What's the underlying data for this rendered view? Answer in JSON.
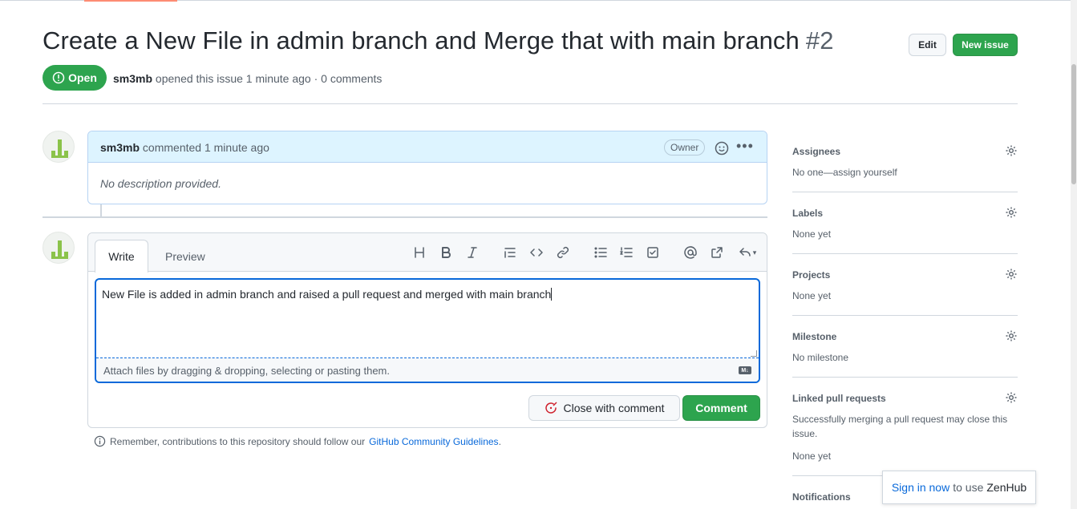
{
  "issue": {
    "title": "Create a New File in admin branch and Merge that with main branch",
    "number": "#2",
    "state": "Open",
    "author": "sm3mb",
    "meta_rest": "opened this issue 1 minute ago · 0 comments"
  },
  "header_buttons": {
    "edit": "Edit",
    "new_issue": "New issue"
  },
  "comment": {
    "author": "sm3mb",
    "action": "commented 1 minute ago",
    "badge": "Owner",
    "body": "No description provided."
  },
  "editor": {
    "tab_write": "Write",
    "tab_preview": "Preview",
    "toolbar": [
      "heading-icon",
      "bold-icon",
      "italic-icon",
      "quote-icon",
      "code-icon",
      "link-icon",
      "bulleted-list-icon",
      "numbered-list-icon",
      "task-list-icon",
      "mention-icon",
      "reference-icon",
      "reply-icon"
    ],
    "text": "New File is added in admin branch and raised a pull request and merged with main branch",
    "attach_hint": "Attach files by dragging & dropping, selecting or pasting them.",
    "md_badge": "M↓",
    "close_with_comment": "Close with comment",
    "comment_button": "Comment"
  },
  "remember": {
    "text": "Remember, contributions to this repository should follow our",
    "link": "GitHub Community Guidelines",
    "end": "."
  },
  "sidebar": {
    "assignees": {
      "heading": "Assignees",
      "value": "No one—assign yourself"
    },
    "labels": {
      "heading": "Labels",
      "value": "None yet"
    },
    "projects": {
      "heading": "Projects",
      "value": "None yet"
    },
    "milestone": {
      "heading": "Milestone",
      "value": "No milestone"
    },
    "linked": {
      "heading": "Linked pull requests",
      "description": "Successfully merging a pull request may close this",
      "description2": "issue.",
      "value": "None yet"
    },
    "notifications": {
      "heading": "Notifications"
    }
  },
  "zenhub": {
    "link": "Sign in now",
    "middle": "to use",
    "brand": "ZenHub"
  },
  "colors": {
    "green": "#2da44e",
    "blue": "#0969da",
    "comment_header": "#ddf4ff"
  }
}
